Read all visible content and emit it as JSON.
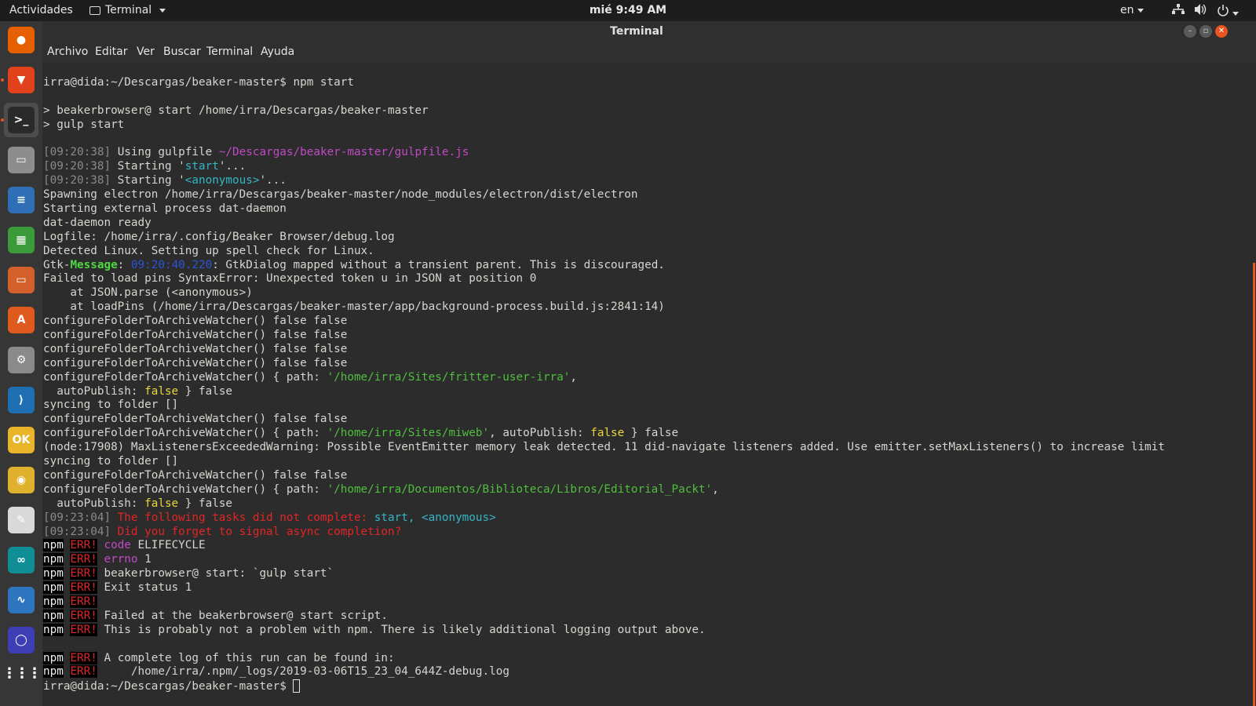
{
  "topbar": {
    "activities": "Actividades",
    "app_menu": "Terminal",
    "clock": "mié  9:49 AM",
    "lang": "en"
  },
  "dock": {
    "items": [
      {
        "name": "firefox",
        "color": "#e66000",
        "glyph": "●"
      },
      {
        "name": "brave",
        "color": "#e2421b",
        "glyph": "▼"
      },
      {
        "name": "terminal",
        "color": "#2a2a2a",
        "glyph": ">_"
      },
      {
        "name": "files",
        "color": "#8d8d8d",
        "glyph": "▭"
      },
      {
        "name": "writer",
        "color": "#2f6fb5",
        "glyph": "≡"
      },
      {
        "name": "calc",
        "color": "#3b9b3b",
        "glyph": "▦"
      },
      {
        "name": "impress",
        "color": "#d35f2a",
        "glyph": "▭"
      },
      {
        "name": "software",
        "color": "#e05a1d",
        "glyph": "A"
      },
      {
        "name": "settings",
        "color": "#8a8a8a",
        "glyph": "⚙"
      },
      {
        "name": "vscode",
        "color": "#1f6fb3",
        "glyph": "⟩"
      },
      {
        "name": "ok",
        "color": "#e7b42a",
        "glyph": "OK"
      },
      {
        "name": "chrome",
        "color": "#e0b12c",
        "glyph": "◉"
      },
      {
        "name": "editor",
        "color": "#d9d9d9",
        "glyph": "✎"
      },
      {
        "name": "arduino",
        "color": "#0f8f95",
        "glyph": "∞"
      },
      {
        "name": "monitor",
        "color": "#2e75c0",
        "glyph": "∿"
      },
      {
        "name": "circle-app",
        "color": "#3f3fb5",
        "glyph": "◯"
      },
      {
        "name": "apps-grid",
        "color": "transparent",
        "glyph": "⋮⋮⋮"
      }
    ]
  },
  "window": {
    "title": "Terminal",
    "menu": [
      "Archivo",
      "Editar",
      "Ver",
      "Buscar",
      "Terminal",
      "Ayuda"
    ]
  },
  "terminal": {
    "lines": [
      "irra@dida:~/Descargas/beaker-master$ npm start",
      "",
      "> beakerbrowser@ start /home/irra/Descargas/beaker-master",
      "> gulp start",
      "",
      "[09:20:38] Using gulpfile ",
      "~/Descargas/beaker-master/gulpfile.js",
      "[09:20:38] Starting '",
      "start",
      "'...",
      "[09:20:38] Starting '",
      "<anonymous>",
      "'...",
      "Spawning electron /home/irra/Descargas/beaker-master/node_modules/electron/dist/electron",
      "Starting external process dat-daemon",
      "dat-daemon ready",
      "Logfile: /home/irra/.config/Beaker Browser/debug.log",
      "Detected Linux. Setting up spell check for Linux.",
      "Gtk-",
      "Message",
      ": ",
      "09:20:40.220",
      ": GtkDialog mapped without a transient parent. This is discouraged.",
      "Failed to load pins SyntaxError: Unexpected token u in JSON at position 0",
      "    at JSON.parse (<anonymous>)",
      "    at loadPins (/home/irra/Descargas/beaker-master/app/background-process.build.js:2841:14)",
      "configureFolderToArchiveWatcher() false false",
      "configureFolderToArchiveWatcher() { path: ",
      "'/home/irra/Sites/fritter-user-irra'",
      ",",
      "  autoPublish: ",
      "false",
      " } false",
      "syncing to folder []",
      "'/home/irra/Sites/miweb'",
      ", autoPublish: ",
      "(node:17908) MaxListenersExceededWarning: Possible EventEmitter memory leak detected. 11 did-navigate listeners added. Use emitter.setMaxListeners() to increase limit",
      "'/home/irra/Documentos/Biblioteca/Libros/Editorial_Packt'",
      "[09:23:04]",
      " The following tasks did not complete: ",
      "start, <anonymous>",
      " Did you forget to signal async completion?",
      "npm",
      "ERR!",
      " code",
      " ELIFECYCLE",
      " errno",
      " 1",
      " beakerbrowser@ start: `gulp start`",
      " Exit status 1",
      " Failed at the beakerbrowser@ start script.",
      " This is probably not a problem with npm. There is likely additional logging output above.",
      " A complete log of this run can be found in:",
      "     /home/irra/.npm/_logs/2019-03-06T15_23_04_644Z-debug.log",
      "irra@dida:~/Descargas/beaker-master$ "
    ]
  }
}
